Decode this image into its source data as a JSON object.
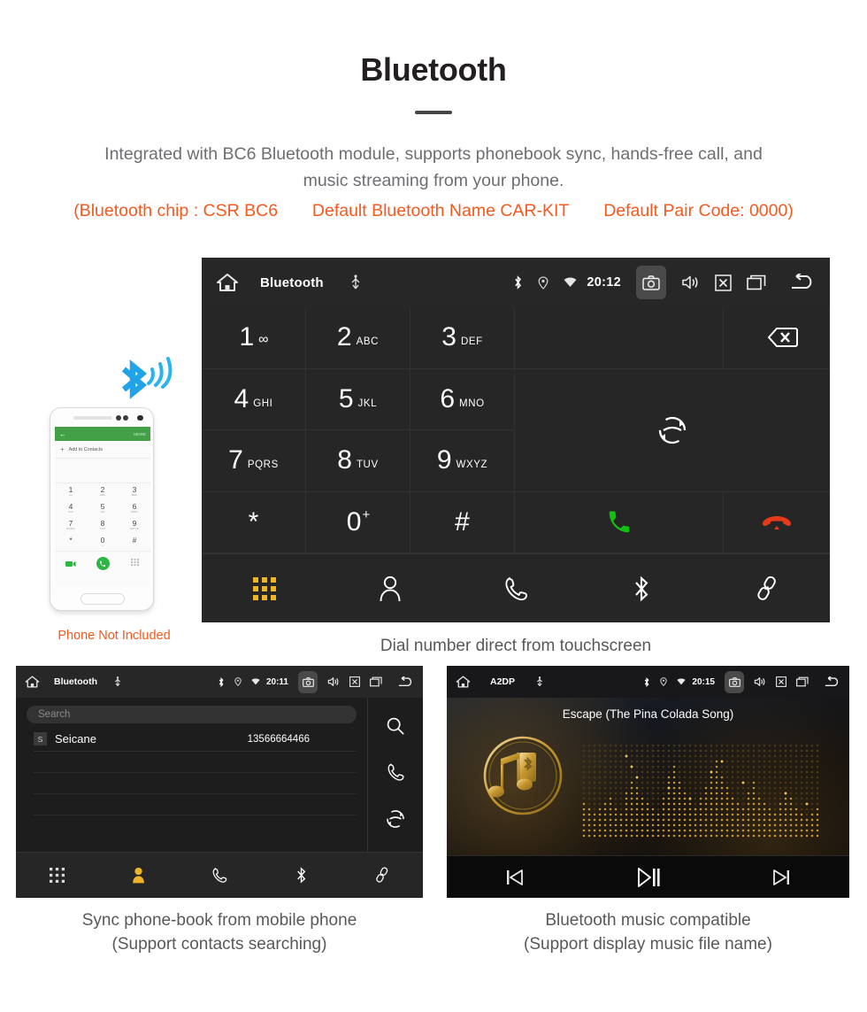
{
  "header": {
    "title": "Bluetooth",
    "intro_line1": "Integrated with BC6 Bluetooth module, supports phonebook sync, hands-free call, and",
    "intro_line2": "music streaming from your phone.",
    "chip": "(Bluetooth chip : CSR BC6",
    "name": "Default Bluetooth Name CAR-KIT",
    "paircode": "Default Pair Code: 0000)",
    "accent_orange": "#f4591f",
    "body_gray": "#6d6e71"
  },
  "dialer": {
    "statusbar": {
      "title": "Bluetooth",
      "time": "20:12",
      "icons": [
        "home-icon",
        "usb-icon",
        "bluetooth-icon",
        "location-icon",
        "wifi-icon",
        "camera-icon",
        "volume-icon",
        "close-icon",
        "recents-icon",
        "back-icon"
      ]
    },
    "keys": [
      {
        "digit": "1",
        "sub": "",
        "glyph": "voicemail"
      },
      {
        "digit": "2",
        "sub": "ABC",
        "glyph": ""
      },
      {
        "digit": "3",
        "sub": "DEF",
        "glyph": ""
      },
      {
        "digit": "4",
        "sub": "GHI",
        "glyph": ""
      },
      {
        "digit": "5",
        "sub": "JKL",
        "glyph": ""
      },
      {
        "digit": "6",
        "sub": "MNO",
        "glyph": ""
      },
      {
        "digit": "7",
        "sub": "PQRS",
        "glyph": ""
      },
      {
        "digit": "8",
        "sub": "TUV",
        "glyph": ""
      },
      {
        "digit": "9",
        "sub": "WXYZ",
        "glyph": ""
      },
      {
        "digit": "*",
        "sub": "",
        "glyph": ""
      },
      {
        "digit": "0",
        "sub": "",
        "glyph": "plus"
      },
      {
        "digit": "#",
        "sub": "",
        "glyph": ""
      }
    ],
    "actions": {
      "backspace": "backspace-icon",
      "transfer": "audio-transfer-icon",
      "call": "call-button",
      "hangup": "hangup-button",
      "call_color": "#13c113",
      "hangup_color": "#e8391a"
    },
    "tabs": [
      {
        "name": "keypad",
        "icon": "keypad-icon",
        "active": true
      },
      {
        "name": "contacts",
        "icon": "person-icon",
        "active": false
      },
      {
        "name": "call-log",
        "icon": "phone-icon",
        "active": false
      },
      {
        "name": "bluetooth",
        "icon": "bluetooth-icon",
        "active": false
      },
      {
        "name": "link",
        "icon": "link-icon",
        "active": false
      }
    ],
    "active_color": "#f0b429",
    "caption": "Dial number direct from touchscreen"
  },
  "phone_art": {
    "header_more": "MORE",
    "add_contacts": "Add to Contacts",
    "keys": [
      {
        "d": "1",
        "s": "oo"
      },
      {
        "d": "2",
        "s": "ABC"
      },
      {
        "d": "3",
        "s": "DEF"
      },
      {
        "d": "4",
        "s": "GHI"
      },
      {
        "d": "5",
        "s": "JKL"
      },
      {
        "d": "6",
        "s": "MNO"
      },
      {
        "d": "7",
        "s": "PQRS"
      },
      {
        "d": "8",
        "s": "TUV"
      },
      {
        "d": "9",
        "s": "WXYZ"
      },
      {
        "d": "*",
        "s": ""
      },
      {
        "d": "0",
        "s": "+"
      },
      {
        "d": "#",
        "s": ""
      }
    ],
    "note": "Phone Not Included",
    "note_color": "#f4591f",
    "bt_color": "#21a3e8"
  },
  "contacts": {
    "statusbar": {
      "title": "Bluetooth",
      "time": "20:11"
    },
    "search_placeholder": "Search",
    "rows": [
      {
        "badge": "S",
        "name": "Seicane",
        "number": "13566664466"
      }
    ],
    "side_icons": [
      "search-icon",
      "phone-icon",
      "sync-icon"
    ],
    "tabs": [
      {
        "name": "keypad",
        "icon": "keypad-icon",
        "active": false
      },
      {
        "name": "contacts",
        "icon": "person-icon",
        "active": true
      },
      {
        "name": "call-log",
        "icon": "phone-icon",
        "active": false
      },
      {
        "name": "bluetooth",
        "icon": "bluetooth-icon",
        "active": false
      },
      {
        "name": "link",
        "icon": "link-icon",
        "active": false
      }
    ],
    "caption_line1": "Sync phone-book from mobile phone",
    "caption_line2": "(Support contacts searching)"
  },
  "music": {
    "statusbar": {
      "title": "A2DP",
      "time": "20:15"
    },
    "song_title": "Escape (The Pina Colada Song)",
    "controls": [
      {
        "name": "previous-track",
        "icon": "prev-icon"
      },
      {
        "name": "play-pause",
        "icon": "play-pause-icon"
      },
      {
        "name": "next-track",
        "icon": "next-icon"
      }
    ],
    "gold": "#c9982f",
    "caption_line1": "Bluetooth music compatible",
    "caption_line2": "(Support display music file name)"
  }
}
